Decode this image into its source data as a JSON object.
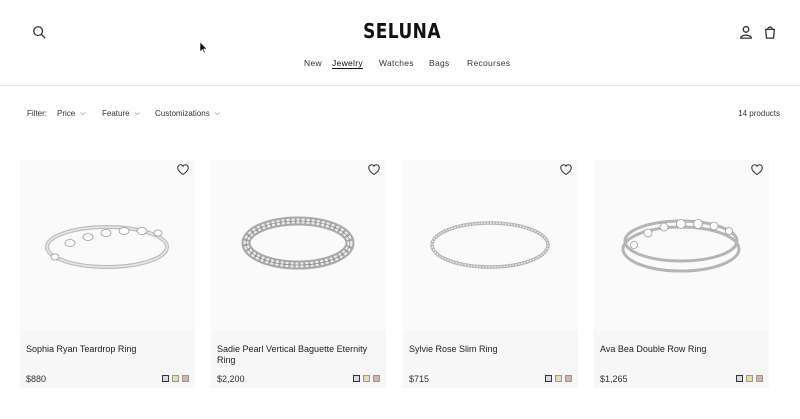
{
  "header": {
    "logo": "SELUNA",
    "nav": [
      "New",
      "Jewelry",
      "Watches",
      "Bags",
      "Recourses"
    ],
    "active_nav": "Jewelry"
  },
  "filters": {
    "label": "Filter:",
    "options": [
      "Price",
      "Feature",
      "Customizations"
    ],
    "count": "14 products"
  },
  "products": [
    {
      "title": "Sophia Ryan Teardrop Ring",
      "price": "$880"
    },
    {
      "title": "Sadie Pearl Vertical Baguette Eternity Ring",
      "price": "$2,200"
    },
    {
      "title": "Sylvie Rose Slim Ring",
      "price": "$715"
    },
    {
      "title": "Ava Bea Double Row Ring",
      "price": "$1,265"
    }
  ],
  "swatch_colors": {
    "silver": "#d9d9d9",
    "gold": "#e9dba4",
    "rose": "#d9b3a8"
  }
}
